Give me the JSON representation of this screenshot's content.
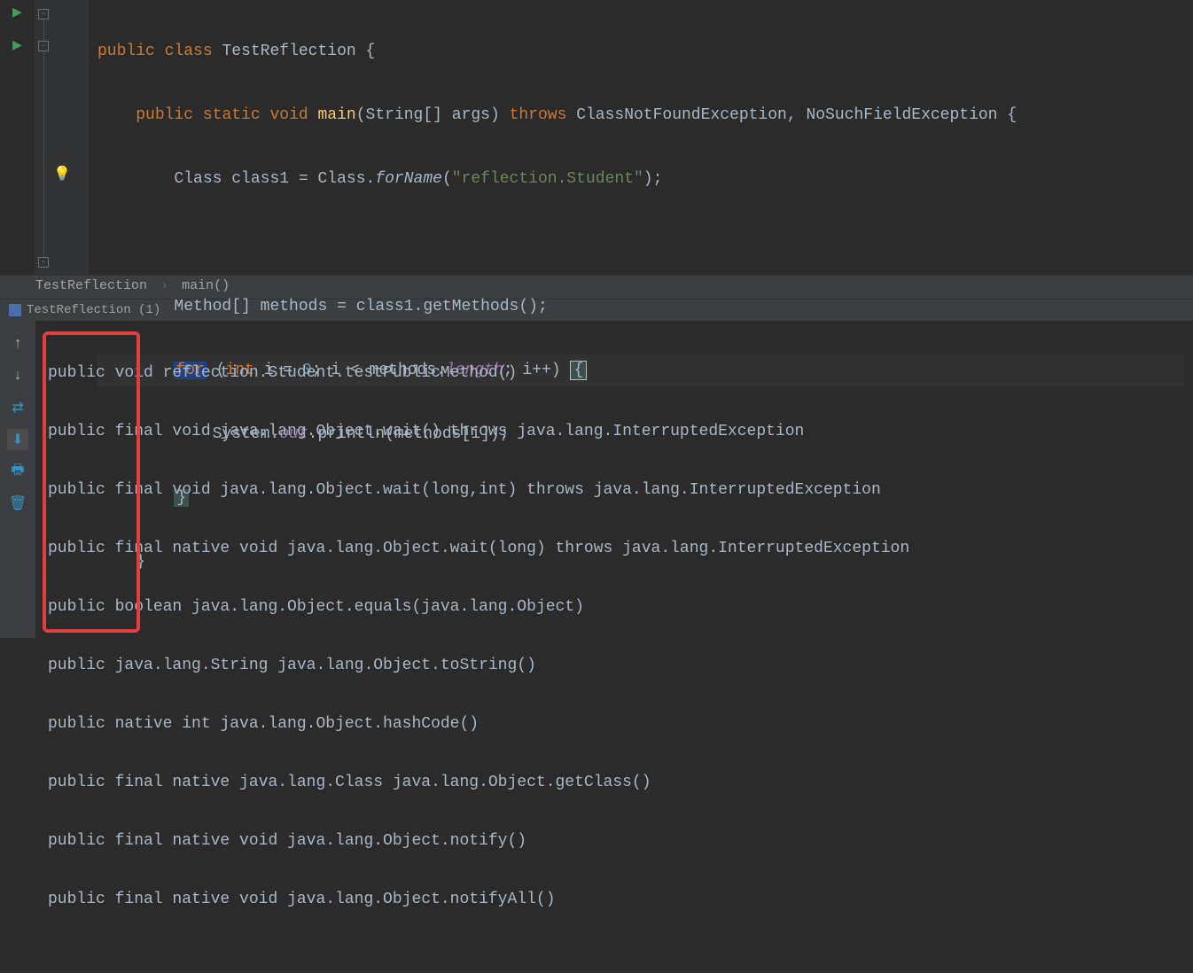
{
  "code": {
    "l1": {
      "kw_public": "public",
      "kw_class": "class",
      "classname": "TestReflection",
      "brace": "{"
    },
    "l2": {
      "kw_public": "public",
      "kw_static": "static",
      "kw_void": "void",
      "method": "main",
      "params": "(String[] args)",
      "kw_throws": "throws",
      "ex1": "ClassNotFoundException",
      "comma": ",",
      "ex2": "NoSuchFieldException",
      "brace": "{"
    },
    "l3": {
      "type1": "Class",
      "var": "class1",
      "eq": "=",
      "type2": "Class.",
      "method": "forName",
      "open": "(",
      "str": "\"reflection.Student\"",
      "close": ");"
    },
    "l5": {
      "type": "Method[]",
      "var": "methods",
      "eq": "=",
      "call": "class1.getMethods();"
    },
    "l6": {
      "kw_for": "for",
      "open": "(",
      "kw_int": "int",
      "init": "i =",
      "zero": "0",
      "semi1": ";",
      "cond1": "i <",
      "arr": "methods.",
      "len": "length",
      "semi2": ";",
      "inc": "i++)",
      "brace": "{"
    },
    "l7": {
      "sys": "System.",
      "out": "out",
      "dot": ".println(methods[i]);"
    },
    "l8": {
      "brace": "}"
    },
    "l10": {
      "brace": "}"
    }
  },
  "breadcrumb": {
    "class": "TestReflection",
    "method": "main()"
  },
  "run_tab": {
    "label": "TestReflection (1)"
  },
  "console": {
    "lines": [
      "public void reflection.Student.testPublicMethod()",
      "public final void java.lang.Object.wait() throws java.lang.InterruptedException",
      "public final void java.lang.Object.wait(long,int) throws java.lang.InterruptedException",
      "public final native void java.lang.Object.wait(long) throws java.lang.InterruptedException",
      "public boolean java.lang.Object.equals(java.lang.Object)",
      "public java.lang.String java.lang.Object.toString()",
      "public native int java.lang.Object.hashCode()",
      "public final native java.lang.Class java.lang.Object.getClass()",
      "public final native void java.lang.Object.notify()",
      "public final native void java.lang.Object.notifyAll()"
    ]
  },
  "toolbar": {
    "up": "↑",
    "down": "↓",
    "wrap": "⇄",
    "scroll": "⬇",
    "print": "🖶",
    "trash": "🗑"
  }
}
